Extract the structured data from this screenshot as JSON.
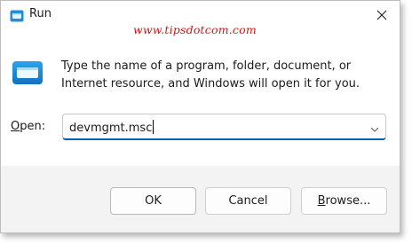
{
  "window": {
    "title": "Run",
    "close_glyph": "✕",
    "app_icon": "run-icon"
  },
  "watermark": "www.tipsdotcom.com",
  "description": {
    "line1": "Type the name of a program, folder, document, or",
    "line2": "Internet resource, and Windows will open it for you."
  },
  "open_field": {
    "label_mnemonic": "O",
    "label_rest": "pen:",
    "value": "devmgmt.msc"
  },
  "buttons": {
    "ok": "OK",
    "cancel": "Cancel",
    "browse_mnemonic": "B",
    "browse_rest": "rowse..."
  },
  "colors": {
    "accent": "#005fb8",
    "watermark": "#cc1818",
    "icon_blue": "#1e8fd8"
  }
}
